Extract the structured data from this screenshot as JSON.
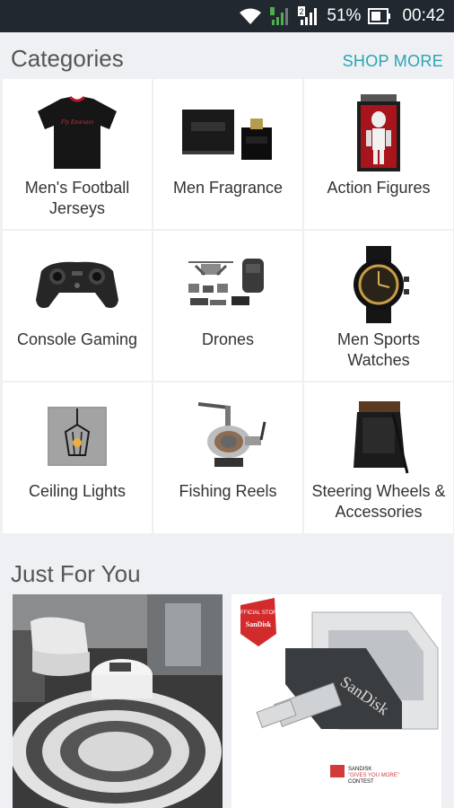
{
  "status_bar": {
    "battery": "51%",
    "time": "00:42",
    "sim_badge": "2",
    "icons": [
      "wifi-icon",
      "signal-icon",
      "signal-icon",
      "battery-icon"
    ]
  },
  "categories": {
    "title": "Categories",
    "shop_more": "SHOP MORE",
    "items": [
      {
        "label": "Men's Football Jerseys",
        "icon": "football-jersey-image"
      },
      {
        "label": "Men Fragrance",
        "icon": "fragrance-image"
      },
      {
        "label": "Action Figures",
        "icon": "action-figure-image"
      },
      {
        "label": "Console Gaming",
        "icon": "game-controller-image"
      },
      {
        "label": "Drones",
        "icon": "drone-image"
      },
      {
        "label": "Men Sports Watches",
        "icon": "sports-watch-image"
      },
      {
        "label": "Ceiling Lights",
        "icon": "ceiling-light-image"
      },
      {
        "label": "Fishing Reels",
        "icon": "fishing-reel-image"
      },
      {
        "label": "Steering Wheels & Accessories",
        "icon": "steering-wheel-image"
      }
    ]
  },
  "just_for_you": {
    "title": "Just For You",
    "products": [
      {
        "icon": "living-room-rug-image"
      },
      {
        "icon": "sandisk-usb-drive-image",
        "brand": "SanDisk",
        "badge": "OFFICIAL STORE",
        "badge_brand": "SanDisk",
        "contest_line1": "SANDISK",
        "contest_line2": "\"GIVES YOU MORE\"",
        "contest_line3": "CONTEST"
      }
    ]
  },
  "jersey_sponsor": "Fly Emirates",
  "colors": {
    "status_bar": "#22282f",
    "accent": "#2aa4b4",
    "background": "#eef0f3"
  }
}
